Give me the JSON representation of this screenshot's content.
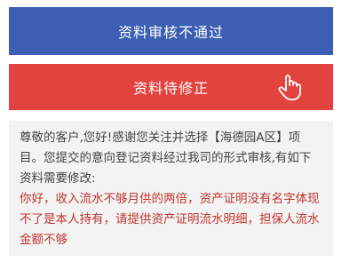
{
  "status": {
    "banner_label": "资料审核不通过"
  },
  "action": {
    "correct_label": "资料待修正",
    "icon": "tap-hand-icon"
  },
  "message": {
    "intro": "尊敬的客户,您好!感谢您关注并选择【海德园A区】项目。您提交的意向登记资料经过我司的形式审核,有如下资料需要修改:",
    "reason": "你好，收入流水不够月供的两倍，资产证明没有名字体现不了是本人持有，请提供资产证明流水明细，担保人流水金额不够"
  },
  "colors": {
    "banner_bg": "#3c5fb3",
    "button_bg": "#e3433f",
    "message_bg": "#f3f3f3",
    "reason_text": "#c0352f"
  }
}
